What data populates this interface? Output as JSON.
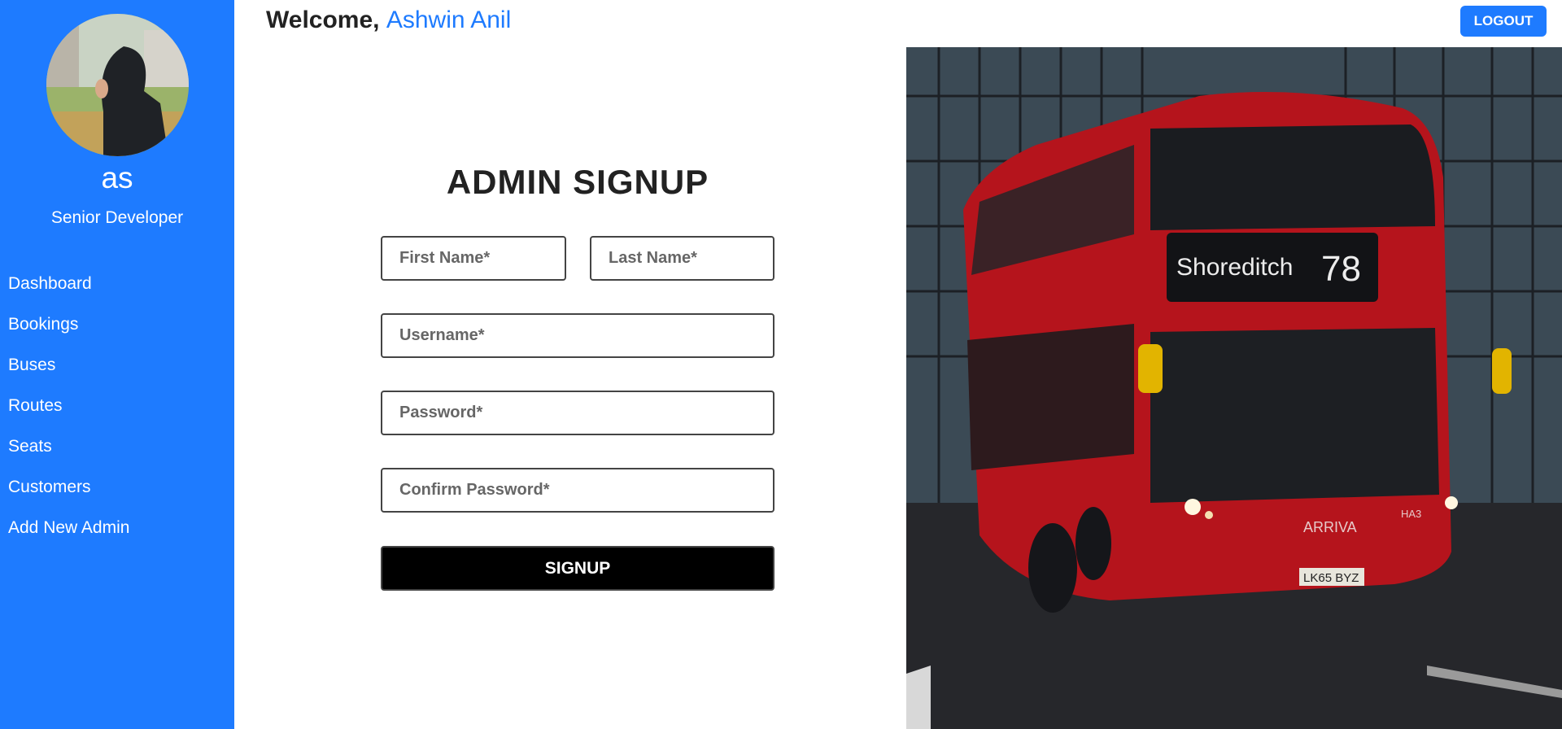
{
  "header": {
    "welcome_prefix": "Welcome,",
    "user_name": "Ashwin Anil",
    "logout_label": "LOGOUT"
  },
  "profile": {
    "name": "as",
    "role": "Senior Developer"
  },
  "sidebar": {
    "items": [
      {
        "label": "Dashboard"
      },
      {
        "label": "Bookings"
      },
      {
        "label": "Buses"
      },
      {
        "label": "Routes"
      },
      {
        "label": "Seats"
      },
      {
        "label": "Customers"
      },
      {
        "label": "Add New Admin"
      }
    ]
  },
  "form": {
    "title": "ADMIN SIGNUP",
    "first_name_placeholder": "First Name*",
    "last_name_placeholder": "Last Name*",
    "username_placeholder": "Username*",
    "password_placeholder": "Password*",
    "confirm_password_placeholder": "Confirm Password*",
    "submit_label": "SIGNUP"
  },
  "photo": {
    "destination": "Shoreditch",
    "route_number": "78",
    "plate": "LK65 BYZ",
    "operator": "ARRIVA",
    "fleet_code": "HA3"
  },
  "colors": {
    "accent": "#1e7bff",
    "button_dark": "#000000",
    "bus_red": "#b5141c"
  }
}
